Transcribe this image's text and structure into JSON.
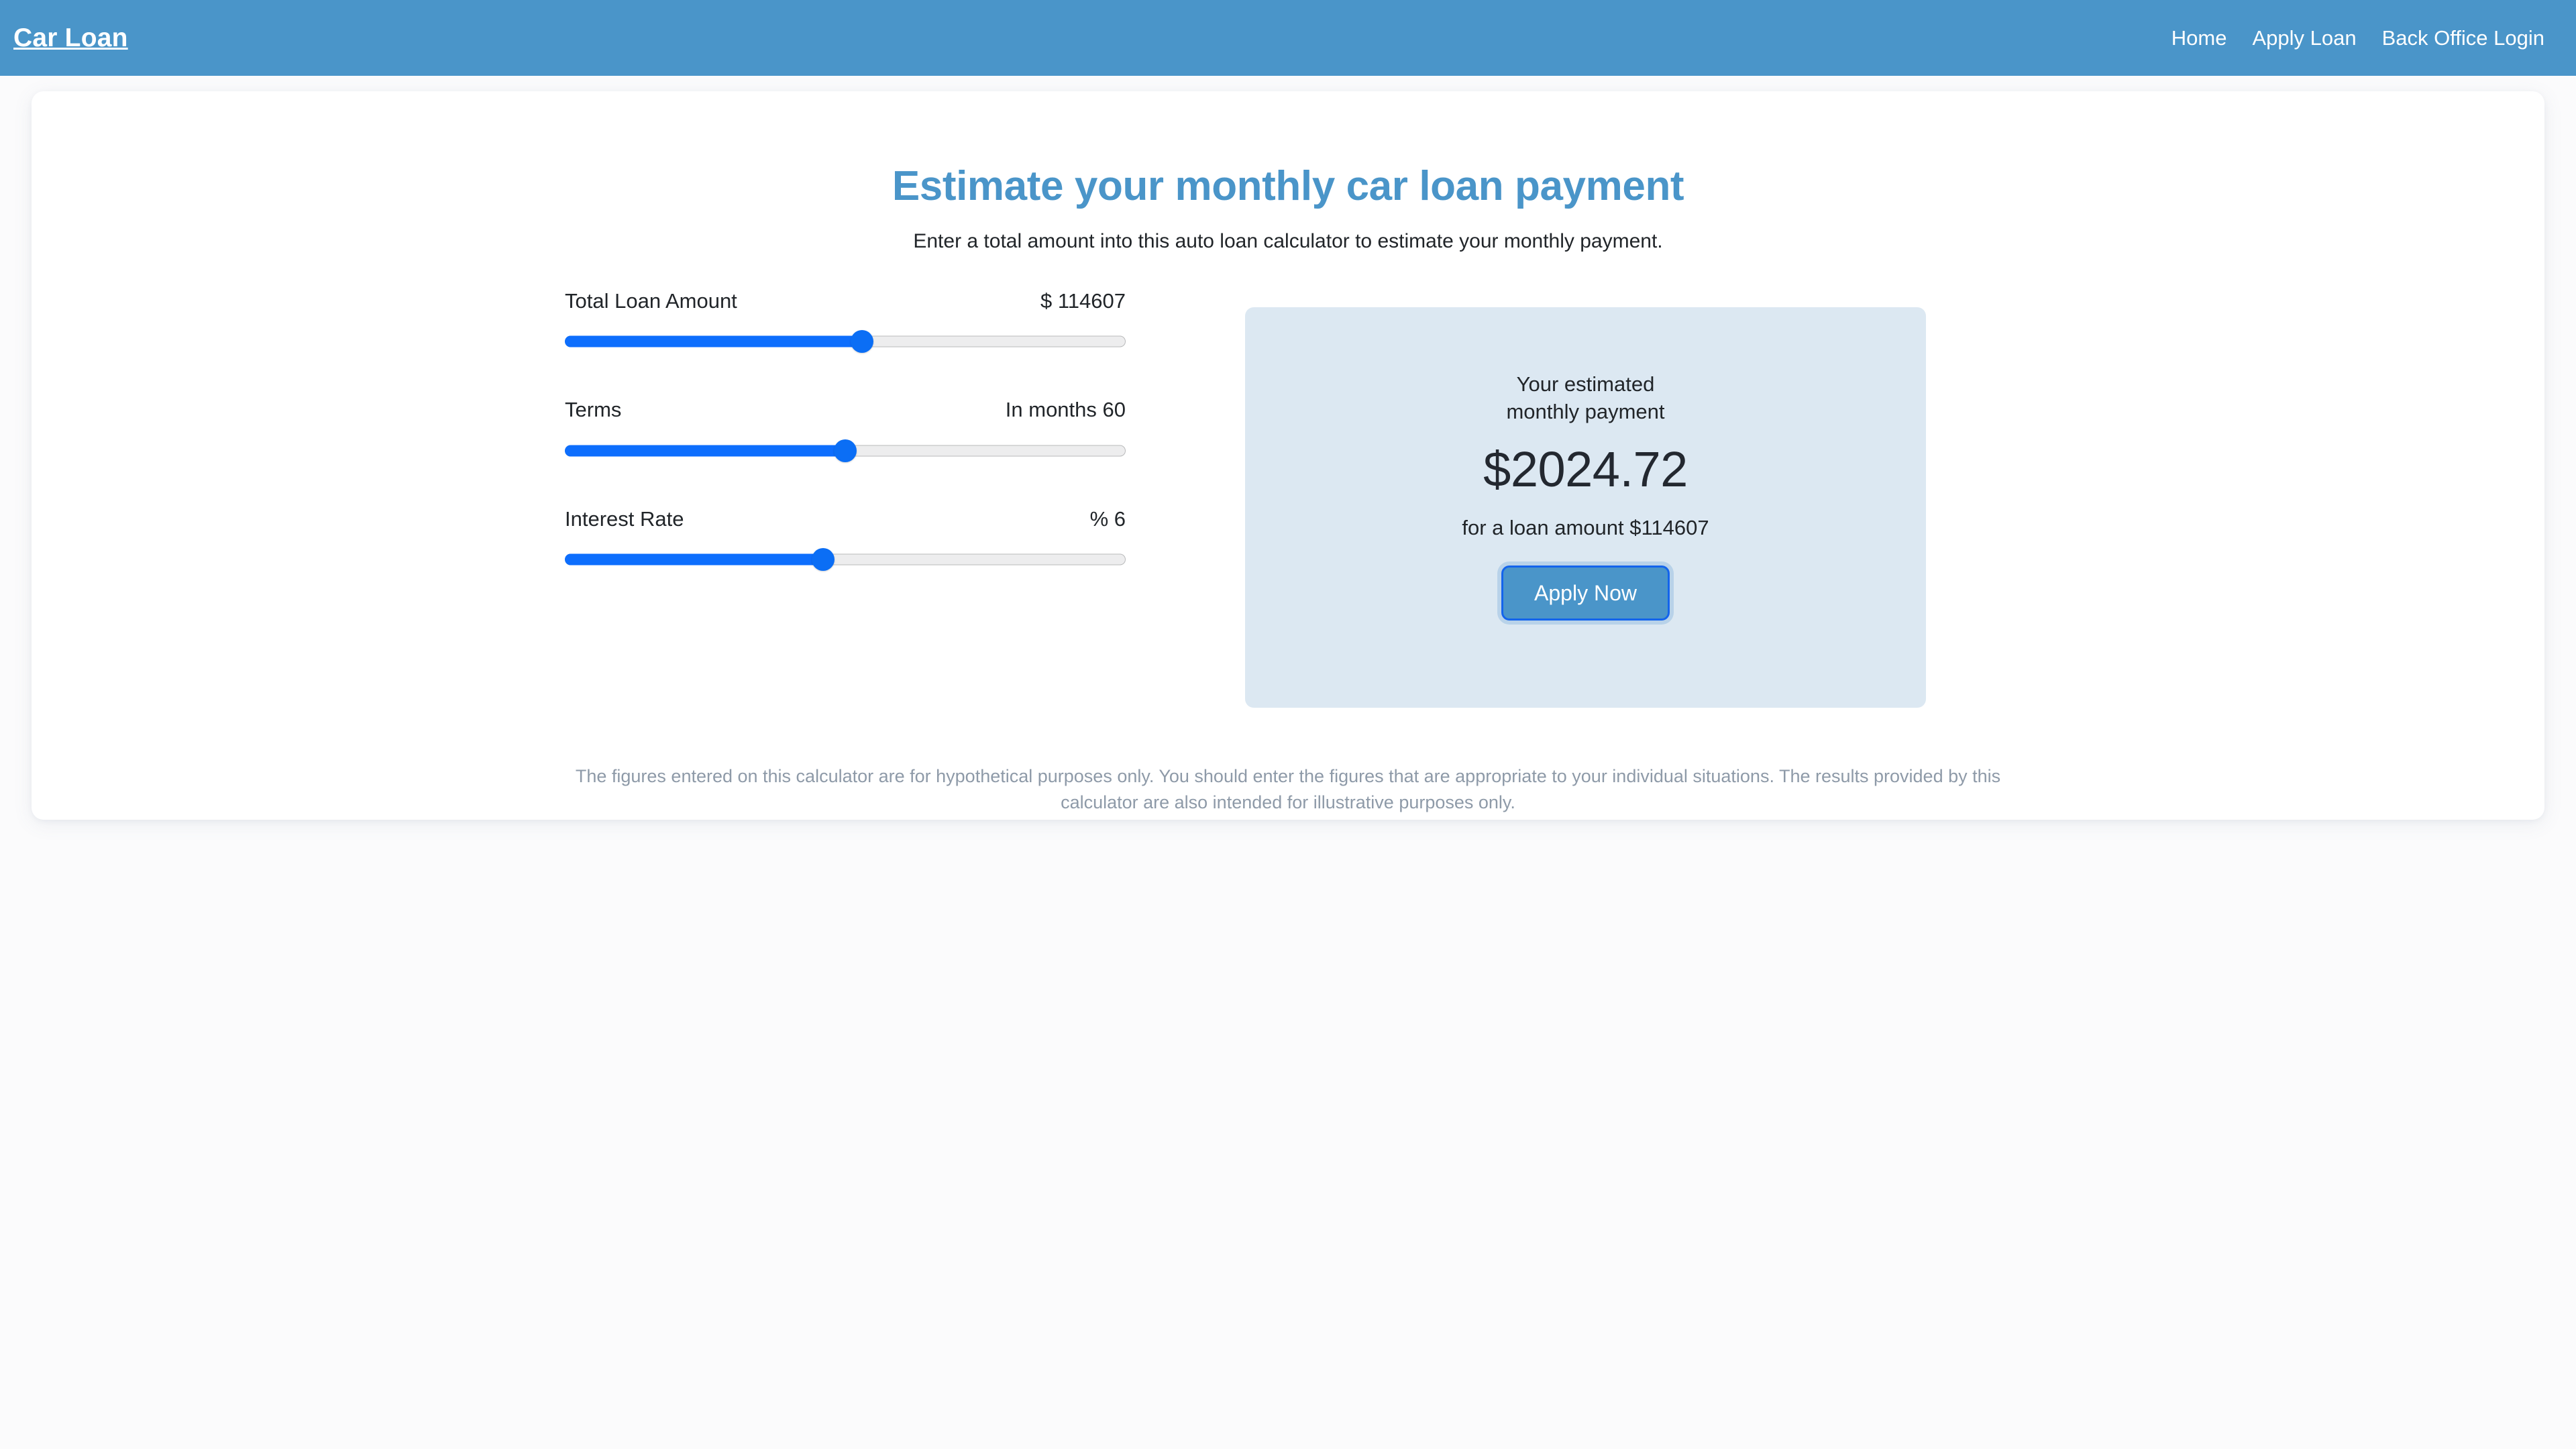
{
  "navbar": {
    "brand": "Car Loan",
    "links": [
      {
        "label": "Home"
      },
      {
        "label": "Apply Loan"
      },
      {
        "label": "Back Office Login"
      }
    ],
    "bg_color": "#4a95c9"
  },
  "hero": {
    "headline": "Estimate your monthly car loan payment",
    "subhead": "Enter a total amount into this auto loan calculator to estimate your monthly payment.",
    "headline_color": "#4a95c9"
  },
  "sliders": [
    {
      "label": "Total Loan Amount",
      "value_text": "$ 114607",
      "value": 114607,
      "percent": 53
    },
    {
      "label": "Terms",
      "value_text": "In months 60",
      "value": 60,
      "percent": 50
    },
    {
      "label": "Interest Rate",
      "value_text": "% 6",
      "value": 6,
      "percent": 46
    }
  ],
  "estimate": {
    "title_line1": "Your estimated",
    "title_line2": "monthly payment",
    "amount": "$2024.72",
    "sub": "for a loan amount $114607",
    "button_label": "Apply Now",
    "card_bg": "#dce8f2",
    "button_bg": "#4a95c9",
    "button_border": "#1364ec"
  },
  "disclaimer": {
    "text": "The figures entered on this calculator are for hypothetical purposes only. You should enter the figures that are appropriate to your individual situations. The results provided by this calculator are also intended for illustrative purposes only."
  }
}
